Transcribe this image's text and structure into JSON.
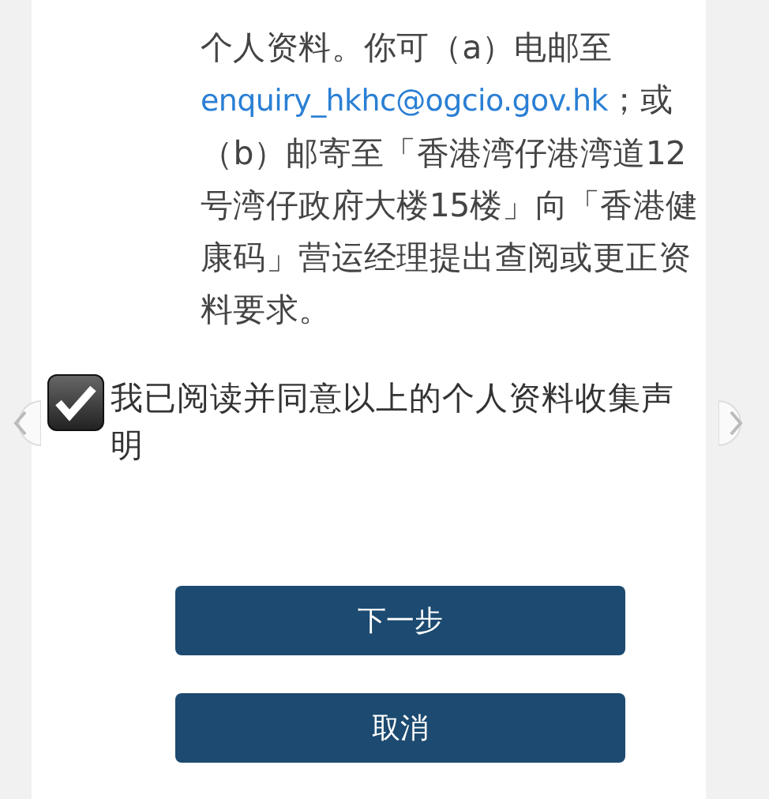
{
  "statement": {
    "before": "个人资料。你可（a）电邮至",
    "link": "enquiry_hkhc@ogcio.gov.hk",
    "after": "；或（b）邮寄至「香港湾仔港湾道12号湾仔政府大楼15楼」向「香港健康码」营运经理提出查阅或更正资料要求。"
  },
  "consent": {
    "label": "我已阅读并同意以上的个人资料收集声明",
    "checked": true
  },
  "buttons": [
    {
      "label": "下一步"
    },
    {
      "label": "取消"
    }
  ]
}
